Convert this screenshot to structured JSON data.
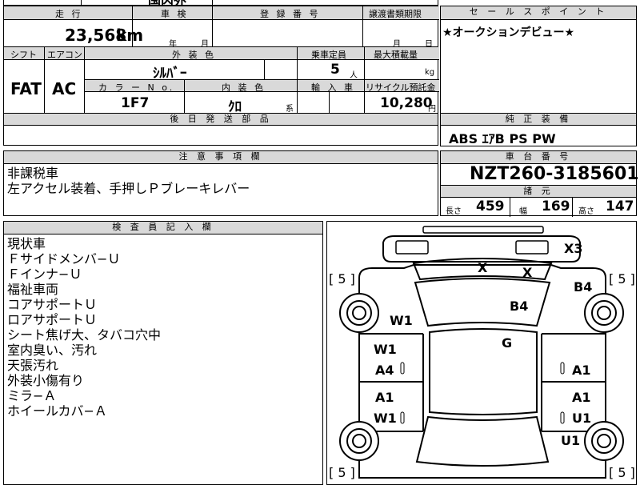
{
  "top_partial": "国内外",
  "row1": {
    "mileage_label": "走 行",
    "mileage_value": "23,568",
    "mileage_unit": "km",
    "inspection_label": "車 検",
    "inspection_year": "年",
    "inspection_month": "月",
    "registration_label": "登 録 番 号",
    "transfer_label": "譲渡書類期限",
    "transfer_month": "月",
    "transfer_day": "日"
  },
  "row2": {
    "shift_label": "シフト",
    "aircon_label": "エアコン",
    "exterior_color_label": "外 装 色",
    "capacity_label": "乗車定員",
    "max_load_label": "最大積載量",
    "shift_value": "FAT",
    "aircon_value": "AC",
    "exterior_color_value": "ｼﾙﾊﾞｰ",
    "capacity_value": "5",
    "capacity_unit": "人",
    "load_unit": "kg",
    "color_no_label": "カ ラ ー N o.",
    "interior_color_label": "内 装 色",
    "import_label": "輸 入 車",
    "recycle_label": "リサイクル預託金",
    "color_no_value": "1F7",
    "interior_color_value": "ｸﾛ",
    "interior_suffix": "系",
    "recycle_value": "10,280",
    "recycle_unit": "円"
  },
  "later_parts_label": "後 日 発 送 部 品",
  "sales_point": {
    "label": "セ ー ル ス ポ イ ン ト",
    "text": "★オークションデビュー★"
  },
  "genuine_equipment": {
    "label": "純 正 装 備",
    "text": "ABS ｴｱB PS PW"
  },
  "caution": {
    "label": "注 意 事 項 欄",
    "lines": [
      "非課税車",
      "左アクセル装着、手押しＰブレーキレバー"
    ]
  },
  "chassis": {
    "label": "車 台 番 号",
    "value": "NZT260-3185601",
    "specs_label": "諸 元",
    "length_label": "長さ",
    "length_value": "459",
    "width_label": "幅",
    "width_value": "169",
    "height_label": "高さ",
    "height_value": "147"
  },
  "inspector": {
    "label": "検 査 員 記 入 欄",
    "lines": [
      "現状車",
      "Ｆサイドメンバ−Ｕ",
      "Ｆインナ−Ｕ",
      "福祉車両",
      "コアサポートＵ",
      "ロアサポートＵ",
      "シート焦げ大、タバコ穴中",
      "室内臭い、汚れ",
      "天張汚れ",
      "外装小傷有り",
      "ミラ−Ａ",
      "ホイールカバ−Ａ"
    ]
  },
  "diagram": {
    "tire_fl": "[ 5 ]",
    "tire_fr": "[ 5 ]",
    "tire_rl": "[ 5 ]",
    "tire_rr": "[ 5 ]",
    "marks": {
      "x3": "X3",
      "x_left": "X",
      "x_right": "X",
      "b4_right": "B4",
      "b4_center": "B4",
      "w1_fender": "W1",
      "g": "G",
      "w1_front_door": "W1",
      "a4": "A4",
      "a1_rf_door": "A1",
      "a1_rear_left": "A1",
      "w1_rear_left": "W1",
      "a1_rear_right": "A1",
      "u1_rear_right": "U1",
      "u1_quarter": "U1"
    }
  }
}
